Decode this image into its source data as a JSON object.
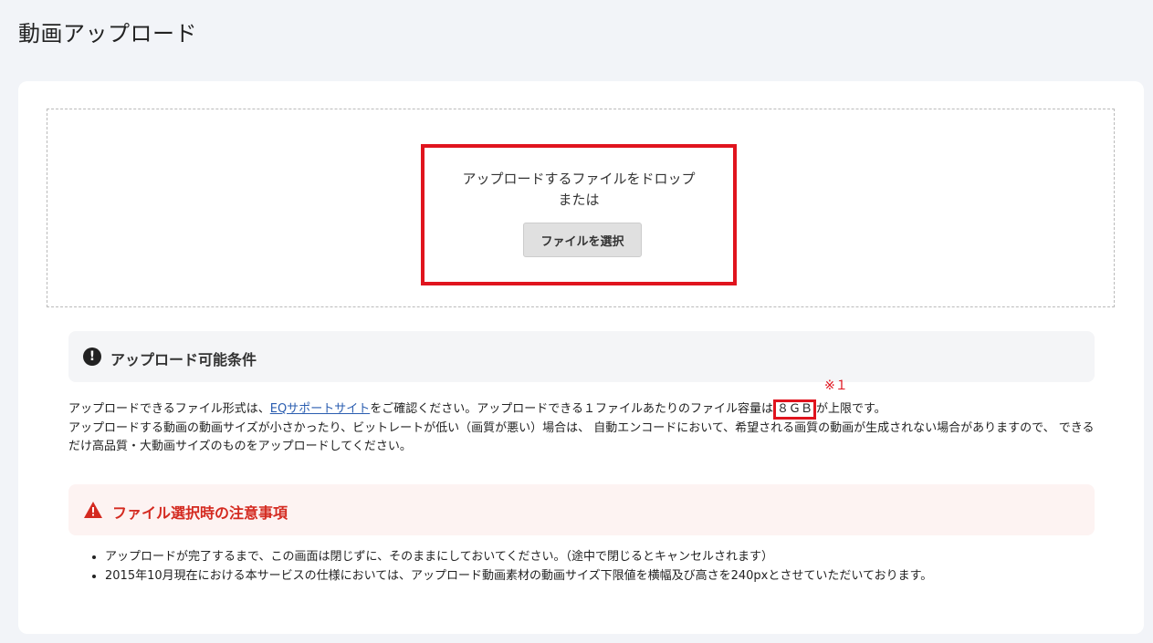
{
  "page": {
    "title": "動画アップロード"
  },
  "dropzone": {
    "line1": "アップロードするファイルをドロップ",
    "line2": "または",
    "button_label": "ファイルを選択"
  },
  "conditions": {
    "title": "アップロード可能条件",
    "note_mark": "※１",
    "text_before_link": "アップロードできるファイル形式は、",
    "link_text": "EQサポートサイト",
    "text_after_link": "をご確認ください。アップロードできる１ファイルあたりのファイル容量は",
    "size_limit": "８ＧＢ",
    "text_after_size": "が上限です。",
    "paragraph2": "アップロードする動画の動画サイズが小さかったり、ビットレートが低い（画質が悪い）場合は、 自動エンコードにおいて、希望される画質の動画が生成されない場合がありますので、 できるだけ高品質・大動画サイズのものをアップロードしてください。"
  },
  "warnings": {
    "title": "ファイル選択時の注意事項",
    "items": [
      "アップロードが完了するまで、この画面は閉じずに、そのままにしておいてください。（途中で閉じるとキャンセルされます）",
      "2015年10月現在における本サービスの仕様においては、アップロード動画素材の動画サイズ下限値を横幅及び高さを240pxとさせていただいております。"
    ]
  },
  "icons": {
    "info": "exclamation-circle-icon",
    "warning": "warning-triangle-icon"
  },
  "colors": {
    "highlight": "#e0141e",
    "warning": "#d42a20",
    "link": "#2a5db0"
  }
}
